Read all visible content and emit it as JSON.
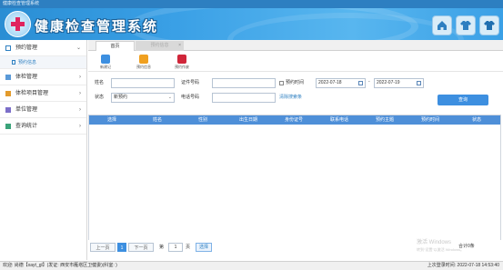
{
  "window": {
    "title": "健康检查管理系统"
  },
  "header": {
    "app_title": "健康检查管理系统",
    "icons": [
      "home-icon",
      "shirt-icon",
      "shirt-blue-icon"
    ]
  },
  "sidebar": {
    "items": [
      {
        "label": "预约管理",
        "icon": "calendar-icon",
        "arrow": "⌄"
      },
      {
        "label": "预约信息",
        "sub": true
      },
      {
        "label": "体检管理",
        "icon": "clipboard-icon",
        "arrow": "›"
      },
      {
        "label": "体检项目管理",
        "icon": "wrench-icon",
        "arrow": "›"
      },
      {
        "label": "单位管理",
        "icon": "building-icon",
        "arrow": "›"
      },
      {
        "label": "查询统计",
        "icon": "chart-icon",
        "arrow": "›"
      }
    ]
  },
  "tabs": {
    "home": "首页",
    "active": "预约信息",
    "close": "×"
  },
  "toolbar": {
    "buttons": [
      {
        "label": "新建记",
        "icon": "new-record-icon",
        "color": "#3d8fe0"
      },
      {
        "label": "预约信息",
        "icon": "folder-icon",
        "color": "#f0a020"
      },
      {
        "label": "预约作废",
        "icon": "delete-icon",
        "color": "#d0263a"
      }
    ]
  },
  "form": {
    "name_label": "姓名",
    "name_value": "",
    "idno_label": "证件号码",
    "idno_value": "",
    "appt_time_label": "预约时间",
    "date_from": "2022-07-18",
    "date_sep": "-",
    "date_to": "2022-07-19",
    "status_label": "状态",
    "status_value": "新预约",
    "phone_label": "电话号码",
    "phone_value": "",
    "clear_link": "清除搜索条",
    "query_button": "查询"
  },
  "table": {
    "columns": [
      "选择",
      "姓名",
      "性别",
      "出生日期",
      "身份证号",
      "联系电话",
      "预约主题",
      "预约时间",
      "状态"
    ]
  },
  "pager": {
    "prev": "上一页",
    "next": "下一页",
    "current": "1",
    "goto_label_pre": "第",
    "goto_value": "1",
    "goto_label_post": "页",
    "go": "选择",
    "total": "合计0条"
  },
  "watermark": {
    "line1": "激活 Windows",
    "line2": "转到“设置”以激活 Windows。"
  },
  "status": {
    "left": "欢迎: 尚德【xayt_gl】(发证: 西安市雁塔区卫健委)(科室: )",
    "right": "上次登录时间: 2022-07-18 14:53:40"
  },
  "colors": {
    "accent": "#3d8fe0",
    "header_blue": "#2d7fc1",
    "grid_header": "#4e8fd8",
    "delete_red": "#d0263a"
  }
}
